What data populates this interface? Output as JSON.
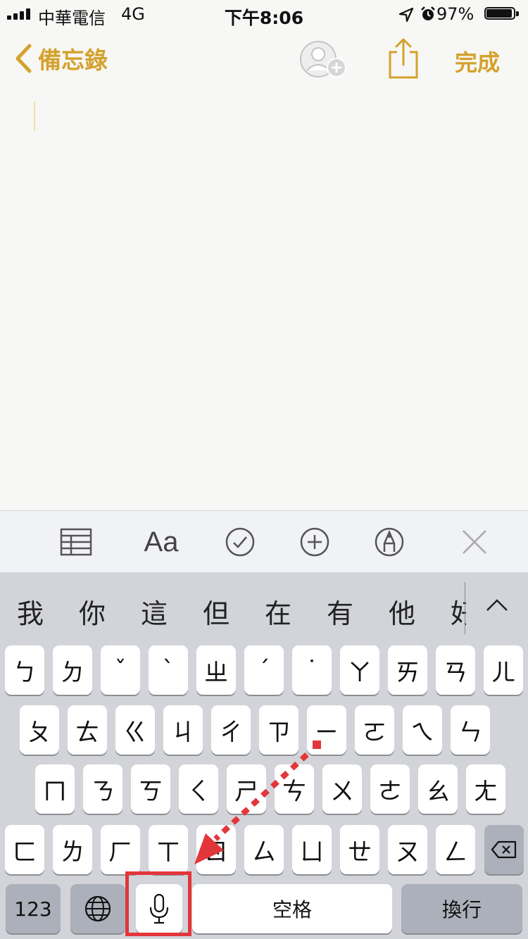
{
  "status_bar": {
    "carrier": "中華電信",
    "network": "4G",
    "time": "下午8:06",
    "battery_percent": "97%",
    "battery_level": 0.97,
    "icons": [
      "signal-icon",
      "location-arrow-icon",
      "alarm-icon",
      "battery-icon"
    ]
  },
  "nav": {
    "back_label": "備忘錄",
    "done_label": "完成",
    "icons": [
      "chevron-left-icon",
      "add-person-icon",
      "share-icon"
    ]
  },
  "toolbar": {
    "icons": [
      "table-icon",
      "text-format-icon",
      "checklist-icon",
      "add-icon",
      "markup-icon",
      "close-icon"
    ],
    "text_format_label": "Aa"
  },
  "keyboard": {
    "candidates": [
      "我",
      "你",
      "這",
      "但",
      "在",
      "有",
      "他",
      "好"
    ],
    "row1": [
      "ㄅ",
      "ㄉ",
      "ˇ",
      "ˋ",
      "ㄓ",
      "ˊ",
      "˙",
      "ㄚ",
      "ㄞ",
      "ㄢ",
      "ㄦ"
    ],
    "row2": [
      "ㄆ",
      "ㄊ",
      "ㄍ",
      "ㄐ",
      "ㄔ",
      "ㄗ",
      "ㄧ",
      "ㄛ",
      "ㄟ",
      "ㄣ"
    ],
    "row3": [
      "ㄇ",
      "ㄋ",
      "ㄎ",
      "ㄑ",
      "ㄕ",
      "ㄘ",
      "ㄨ",
      "ㄜ",
      "ㄠ",
      "ㄤ"
    ],
    "row4": [
      "ㄈ",
      "ㄌ",
      "ㄏ",
      "ㄒ",
      "ㄖ",
      "ㄙ",
      "ㄩ",
      "ㄝ",
      "ㄡ",
      "ㄥ"
    ],
    "numbers_label": "123",
    "space_label": "空格",
    "return_label": "換行",
    "highlight_color": "#e3363a"
  }
}
